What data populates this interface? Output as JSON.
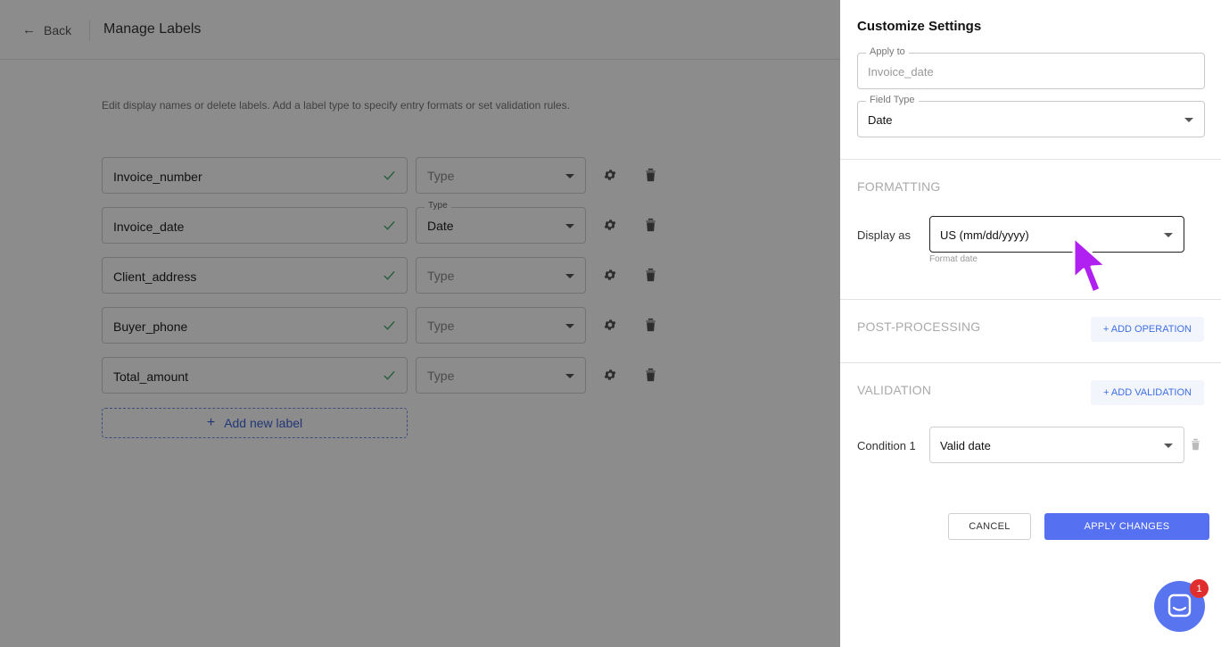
{
  "header": {
    "back_label": "Back",
    "title": "Manage Labels"
  },
  "help_text": "Edit display names or delete labels. Add a label type to specify entry formats or set validation rules.",
  "labels": [
    {
      "name": "Invoice_number",
      "type": "Type",
      "type_set": false
    },
    {
      "name": "Invoice_date",
      "type": "Date",
      "type_set": true,
      "type_float_label": "Type"
    },
    {
      "name": "Client_address",
      "type": "Type",
      "type_set": false
    },
    {
      "name": "Buyer_phone",
      "type": "Type",
      "type_set": false
    },
    {
      "name": "Total_amount",
      "type": "Type",
      "type_set": false
    }
  ],
  "add_label": "Add new label",
  "drawer": {
    "title": "Customize Settings",
    "apply_to": {
      "legend": "Apply to",
      "value": "Invoice_date"
    },
    "field_type": {
      "legend": "Field Type",
      "value": "Date"
    },
    "formatting": {
      "heading": "FORMATTING",
      "display_label": "Display as",
      "display_value": "US (mm/dd/yyyy)",
      "helper": "Format date"
    },
    "post_processing": {
      "heading": "POST-PROCESSING",
      "add_button": "+ ADD OPERATION"
    },
    "validation": {
      "heading": "VALIDATION",
      "add_button": "+ ADD VALIDATION",
      "condition_label": "Condition 1",
      "condition_value": "Valid date"
    },
    "cancel_label": "CANCEL",
    "apply_label": "APPLY CHANGES"
  },
  "chat": {
    "badge_count": "1"
  },
  "colors": {
    "accent": "#5670f2",
    "check": "#4caf6e",
    "cursor": "#b020f0",
    "badge": "#e02d2d"
  }
}
